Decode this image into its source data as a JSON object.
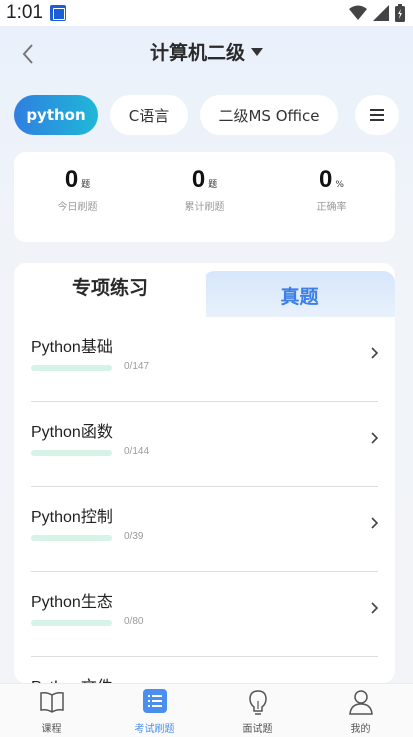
{
  "status_bar": {
    "time": "1:01"
  },
  "header": {
    "title": "计算机二级"
  },
  "subjects": [
    {
      "label": "python",
      "active": true
    },
    {
      "label": "C语言",
      "active": false
    },
    {
      "label": "二级MS Office",
      "active": false
    }
  ],
  "stats": [
    {
      "value": "0",
      "unit": "题",
      "label": "今日刷题"
    },
    {
      "value": "0",
      "unit": "题",
      "label": "累计刷题"
    },
    {
      "value": "0",
      "unit": "%",
      "label": "正确率"
    }
  ],
  "practice": {
    "tabs": [
      "专项练习",
      "真题"
    ],
    "items": [
      {
        "title": "Python基础",
        "count": "0/147"
      },
      {
        "title": "Python函数",
        "count": "0/144"
      },
      {
        "title": "Python控制",
        "count": "0/39"
      },
      {
        "title": "Python生态",
        "count": "0/80"
      },
      {
        "title": "Python文件",
        "count": ""
      }
    ]
  },
  "nav": [
    {
      "label": "课程",
      "icon": "book-icon"
    },
    {
      "label": "考试刷题",
      "icon": "list-icon",
      "active": true
    },
    {
      "label": "面试题",
      "icon": "lightbulb-icon"
    },
    {
      "label": "我的",
      "icon": "user-icon"
    }
  ],
  "colors": {
    "accent": "#4a8ff0",
    "chip_gradient_start": "#2f7fe0",
    "chip_gradient_end": "#1fb8d8",
    "progress": "#d6f3e8"
  }
}
